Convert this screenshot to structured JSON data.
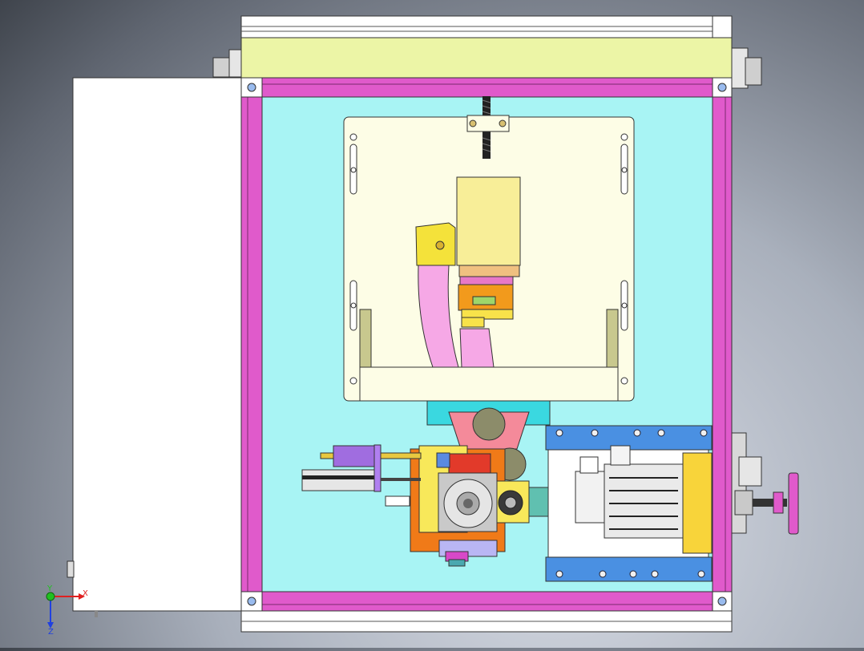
{
  "view": {
    "title": "",
    "type": "CAD assembly top view"
  },
  "triad": {
    "x_label": "X",
    "y_label": "Y",
    "z_label": "Z",
    "x_color": "#e02020",
    "y_color": "#20c020",
    "z_color": "#2040e0"
  },
  "colors": {
    "frame": "#e05acb",
    "base_plate": "#a8f4f4",
    "top_rail": "#ecf5a6",
    "carriage_plate": "#fdfde6",
    "door_panel": "#ffffff",
    "motor_mount": "#4a90e2",
    "orange": "#f29a1c",
    "yellow": "#f8e85a",
    "pink_belt": "#f6a8e6",
    "red": "#e23a2a",
    "purple": "#9b6de0"
  },
  "icons": [
    "coordinate-triad-icon",
    "handwheel-icon",
    "servo-motor-icon"
  ]
}
